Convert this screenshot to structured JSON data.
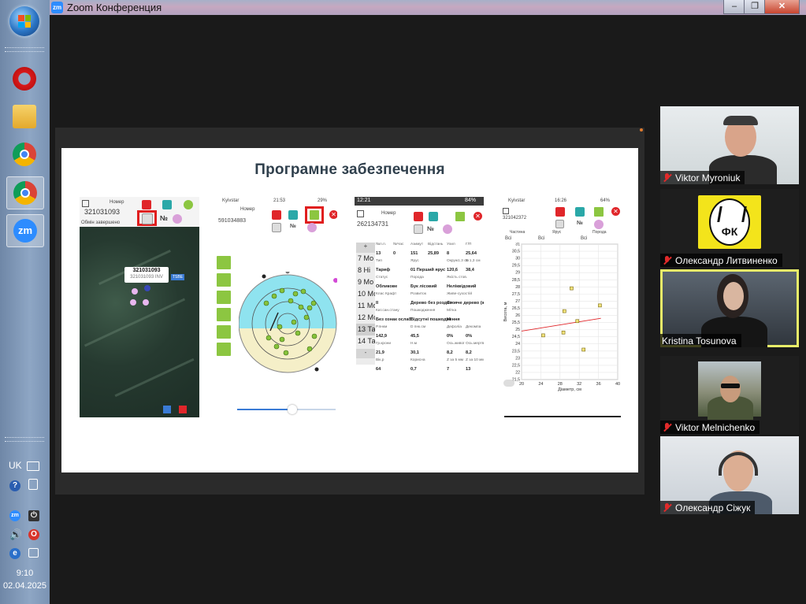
{
  "window": {
    "title": "Zoom Конференция",
    "app_icon_label": "zm"
  },
  "taskbar": {
    "apps": [
      {
        "name": "Opera"
      },
      {
        "name": "Windows Explorer"
      },
      {
        "name": "Google Chrome"
      },
      {
        "name": "Google Chrome (profile)"
      },
      {
        "name": "Zoom",
        "label": "zm"
      }
    ],
    "language": "UK",
    "time": "9:10",
    "date": "02.04.2025"
  },
  "presentation": {
    "slide_title": "Програмне забезпечення",
    "screenshot1": {
      "label_nomer": "Номер",
      "plot_number": "321031093",
      "status": "Обмін завершено",
      "popup_title": "321031093",
      "popup_sub": "321031093 INV",
      "map_tag": "TSBE",
      "number_sign": "№"
    },
    "screenshot2": {
      "carrier": "Kyivstar",
      "time": "21:53",
      "battery": "29%",
      "label_nomer": "Номер",
      "plot_number": "591034883",
      "number_sign": "№"
    },
    "screenshot3": {
      "time": "12:21",
      "battery": "84%",
      "label_nomer": "Номер",
      "plot_number": "262134731",
      "number_sign": "№",
      "list": [
        "7 Мо",
        "8 Ні",
        "9 Мо",
        "10 Мо",
        "11 Мо",
        "12 Мо",
        "13 Та",
        "14 Та"
      ],
      "rows": [
        [
          "№п.п.",
          "№Час",
          "Азимут",
          "Відстань",
          "Ухил",
          "Г/П"
        ],
        [
          "13",
          "0",
          "151",
          "25,89",
          "8",
          "25,64"
        ],
        [
          "Тип",
          "",
          "Ярус",
          "",
          "Окруж1.3 см",
          "D 1,3 см"
        ],
        [
          "Тариф",
          "",
          "01 Перший ярус",
          "",
          "120,6",
          "38,4"
        ],
        [
          "Статус",
          "",
          "Порода",
          "",
          "Якість стов.",
          ""
        ],
        [
          "Обликове",
          "",
          "Бук лісовий",
          "",
          "Неліквідовий",
          ""
        ],
        [
          "Клас Крафт",
          "",
          "Розвиток",
          "",
          "Живе-сухостій",
          ""
        ],
        [
          "II",
          "",
          "Дерево без роздво",
          "",
          "Стояче дерево (живе)",
          ""
        ],
        [
          "Кат.сан.стану",
          "",
          "Пошкодження",
          "",
          "Мітка",
          ""
        ],
        [
          "Без ознак ослаб",
          "",
          "Відсутні пошкодження",
          "",
          "Ні",
          ""
        ],
        [
          "Р.пнкм",
          "",
          "D пнк.см",
          "",
          "Дефоліа",
          "Декомпа"
        ],
        [
          "142,9",
          "",
          "45,5",
          "",
          "0%",
          "0%"
        ],
        [
          "Гр.крони",
          "",
          "Н.м",
          "",
          "Ось.живої",
          "Ось.мертвої"
        ],
        [
          "21,9",
          "",
          "30,1",
          "",
          "8,2",
          "8,2"
        ],
        [
          "Вік,р",
          "",
          "Корисна",
          "",
          "Z за 5 мм",
          "Z за 10 мм"
        ],
        [
          "64",
          "",
          "0,7",
          "",
          "7",
          "13"
        ]
      ]
    },
    "screenshot4": {
      "carrier": "Kyivstar",
      "time": "16:26",
      "battery": "64%",
      "plot_number": "321042372",
      "number_sign": "№",
      "filter_labels": [
        "Частина",
        "Ярус",
        "Порода"
      ],
      "filter_values": [
        "Всі",
        "Всі",
        "Всі"
      ]
    }
  },
  "chart_data": {
    "type": "scatter",
    "title": "",
    "xlabel": "Діаметр, см",
    "ylabel": "Висота, м",
    "xlim": [
      20,
      40
    ],
    "ylim": [
      21.5,
      31
    ],
    "x_ticks": [
      "20",
      "24",
      "28",
      "32",
      "36",
      "40"
    ],
    "y_ticks": [
      "31",
      "30,5",
      "30",
      "29,5",
      "29",
      "28,5",
      "28",
      "27,5",
      "27",
      "26,5",
      "26",
      "25,5",
      "25",
      "24,5",
      "24",
      "23,5",
      "23",
      "22,5",
      "22",
      "21,5"
    ],
    "grid": true,
    "series": [
      {
        "points": [
          [
            24.5,
            24.6
          ],
          [
            28.7,
            24.8
          ],
          [
            28.9,
            26.3
          ],
          [
            30.4,
            27.9
          ],
          [
            31.6,
            25.6
          ],
          [
            32.9,
            23.6
          ],
          [
            36.3,
            26.7
          ]
        ]
      }
    ],
    "trendline": [
      [
        20,
        24.9
      ],
      [
        36.5,
        25.8
      ]
    ],
    "colors": {
      "points": "#f2e27a",
      "point_edge": "#7a6a10",
      "trend": "#e0262a"
    }
  },
  "participants": [
    {
      "name": "Viktor Myroniuk",
      "muted": true,
      "video": true
    },
    {
      "name": "Олександр Литвиненко",
      "muted": true,
      "video": false,
      "logo_text": "ФК"
    },
    {
      "name": "Kristina Tosunova",
      "muted": false,
      "video": true,
      "active_speaker": true
    },
    {
      "name": "Viktor Melnichenko",
      "muted": true,
      "video": true
    },
    {
      "name": "Олександр Сіжук",
      "muted": true,
      "video": true
    }
  ],
  "colors": {
    "zoom_blue": "#2d8cff",
    "active_speaker": "#e8ee69",
    "app_green": "#8cc641",
    "app_red": "#e0262a"
  }
}
